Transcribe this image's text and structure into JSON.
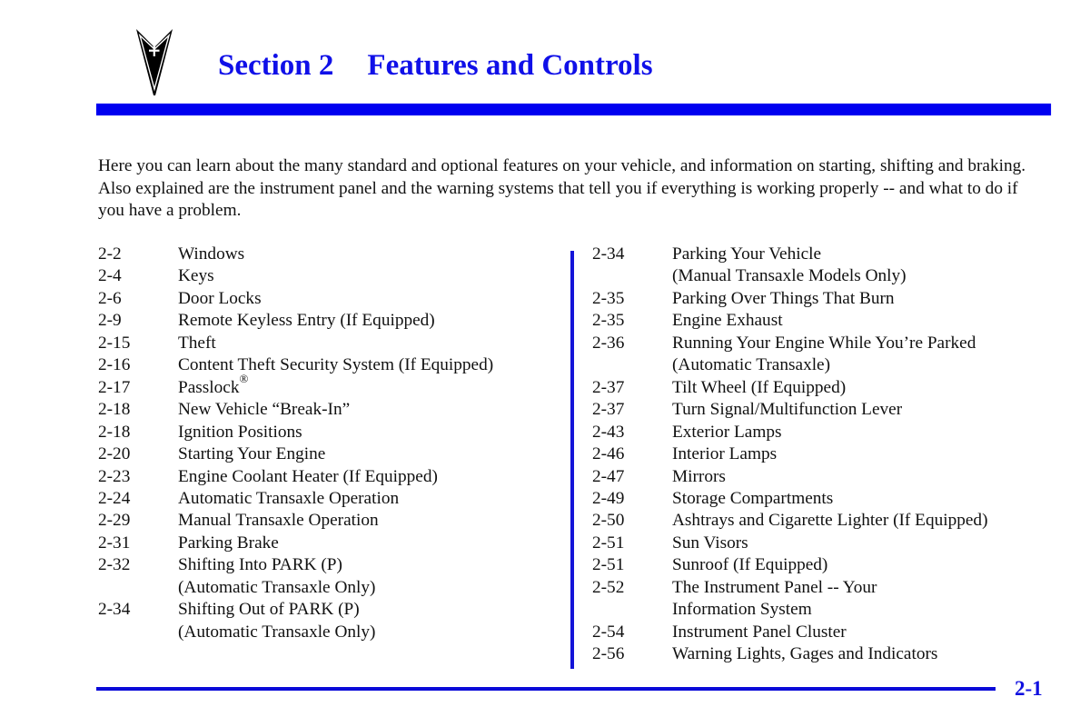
{
  "header": {
    "logo_icon": "pontiac-arrowhead-icon",
    "section_number": "Section 2",
    "section_title": "Features and Controls",
    "accent_color": "#0000F0"
  },
  "intro": {
    "text": "Here you can learn about the many standard and optional features on your vehicle, and information on starting, shifting and braking. Also explained are the instrument panel and the warning systems that tell you if everything is working properly -- and what to do if you have a problem."
  },
  "toc": {
    "left": [
      {
        "page": "2-2",
        "title": "Windows"
      },
      {
        "page": "2-4",
        "title": "Keys"
      },
      {
        "page": "2-6",
        "title": "Door Locks"
      },
      {
        "page": "2-9",
        "title": "Remote Keyless Entry (If Equipped)"
      },
      {
        "page": "2-15",
        "title": "Theft"
      },
      {
        "page": "2-16",
        "title": "Content Theft Security System (If Equipped)"
      },
      {
        "page": "2-17",
        "title": "Passlock",
        "superscript": "®"
      },
      {
        "page": "2-18",
        "title": "New Vehicle “Break-In”"
      },
      {
        "page": "2-18",
        "title": "Ignition Positions"
      },
      {
        "page": "2-20",
        "title": "Starting Your Engine"
      },
      {
        "page": "2-23",
        "title": "Engine Coolant Heater (If Equipped)"
      },
      {
        "page": "2-24",
        "title": "Automatic Transaxle Operation"
      },
      {
        "page": "2-29",
        "title": "Manual Transaxle Operation"
      },
      {
        "page": "2-31",
        "title": "Parking Brake"
      },
      {
        "page": "2-32",
        "title": "Shifting Into PARK (P)\n(Automatic Transaxle Only)"
      },
      {
        "page": "2-34",
        "title": "Shifting Out of PARK (P)\n(Automatic Transaxle Only)"
      }
    ],
    "right": [
      {
        "page": "2-34",
        "title": "Parking Your Vehicle\n(Manual Transaxle Models Only)"
      },
      {
        "page": "2-35",
        "title": "Parking Over Things That Burn"
      },
      {
        "page": "2-35",
        "title": "Engine Exhaust"
      },
      {
        "page": "2-36",
        "title": "Running Your Engine While You’re Parked\n(Automatic Transaxle)"
      },
      {
        "page": "2-37",
        "title": "Tilt Wheel (If Equipped)"
      },
      {
        "page": "2-37",
        "title": "Turn Signal/Multifunction Lever"
      },
      {
        "page": "2-43",
        "title": "Exterior Lamps"
      },
      {
        "page": "2-46",
        "title": "Interior Lamps"
      },
      {
        "page": "2-47",
        "title": "Mirrors"
      },
      {
        "page": "2-49",
        "title": "Storage Compartments"
      },
      {
        "page": "2-50",
        "title": "Ashtrays and Cigarette Lighter (If Equipped)"
      },
      {
        "page": "2-51",
        "title": "Sun Visors"
      },
      {
        "page": "2-51",
        "title": "Sunroof (If Equipped)"
      },
      {
        "page": "2-52",
        "title": "The Instrument Panel -- Your\nInformation System"
      },
      {
        "page": "2-54",
        "title": "Instrument Panel Cluster"
      },
      {
        "page": "2-56",
        "title": "Warning Lights, Gages and Indicators"
      }
    ]
  },
  "footer": {
    "page_number": "2-1"
  }
}
